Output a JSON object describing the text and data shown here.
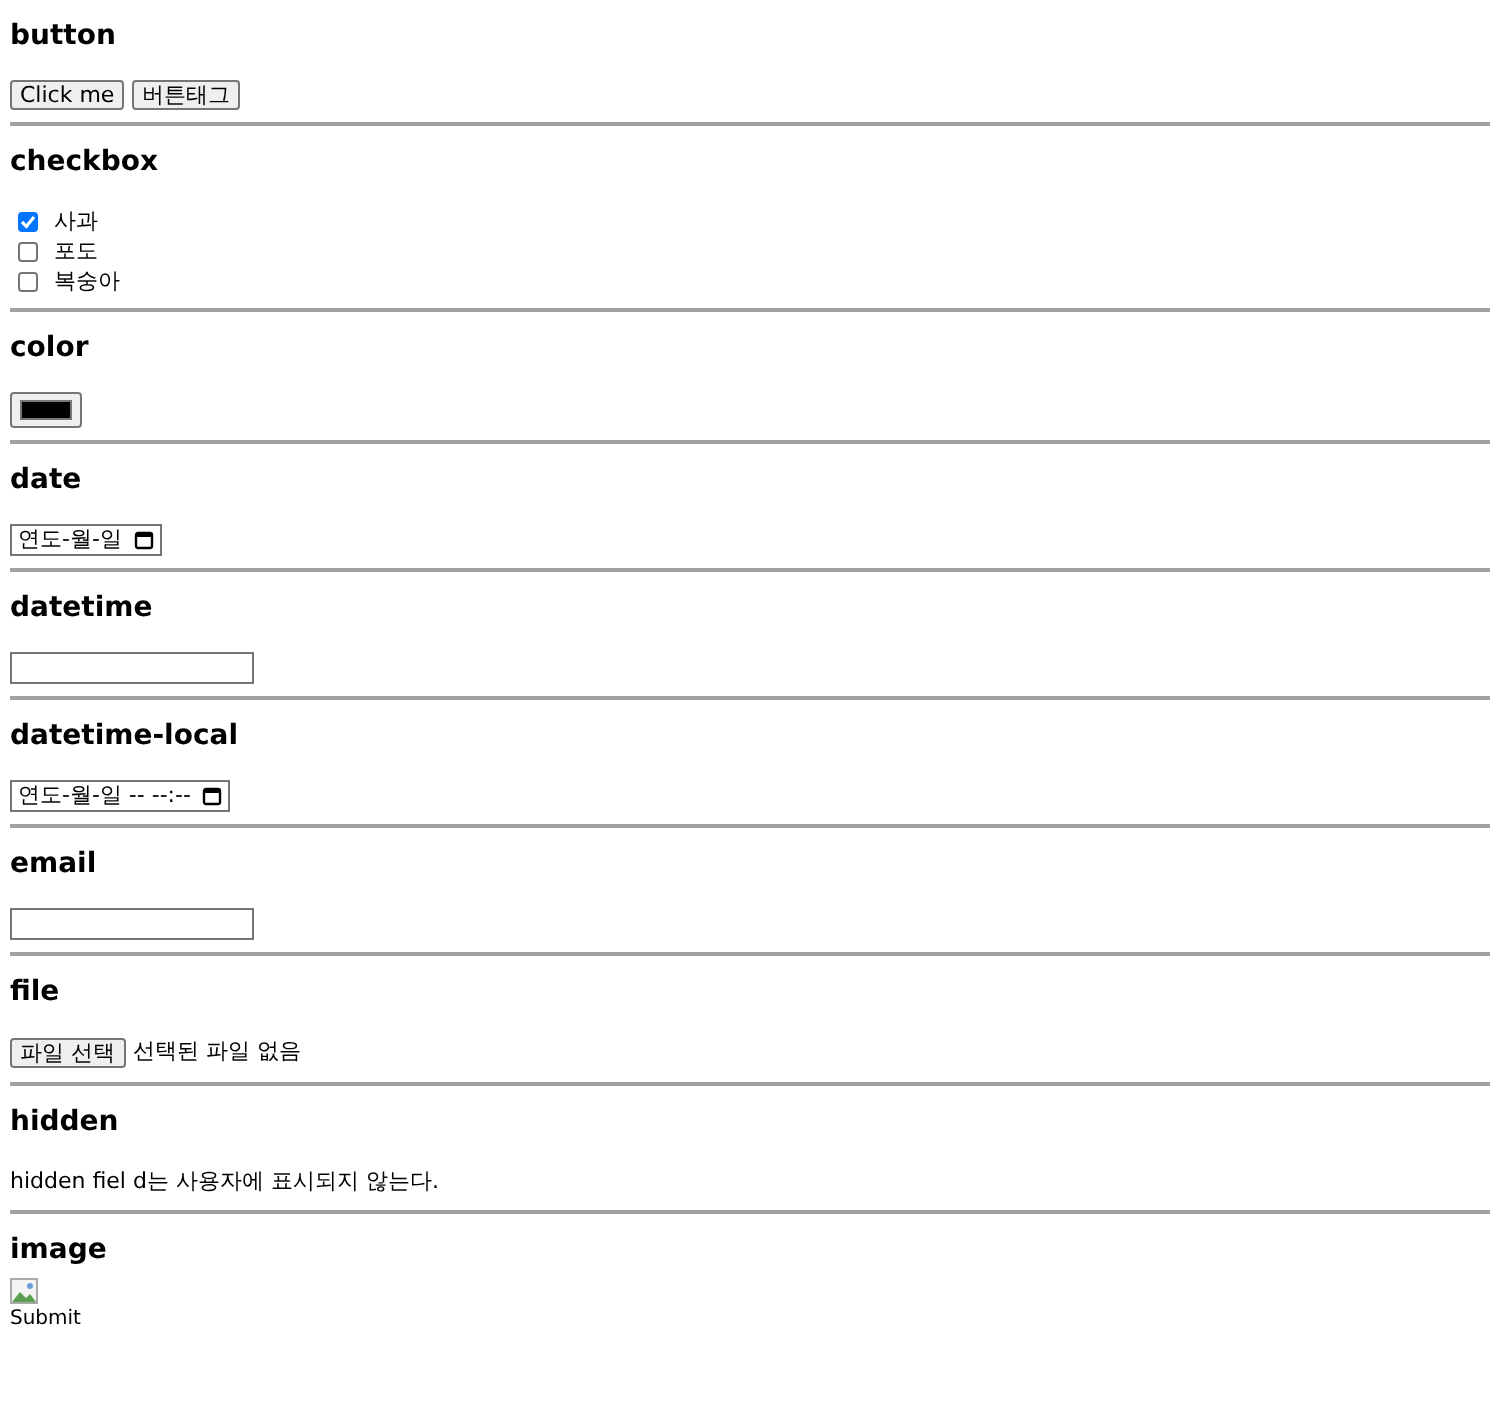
{
  "sections": [
    {
      "kind": "buttons",
      "heading": "button",
      "buttons": [
        "Click me",
        "버튼태그"
      ]
    },
    {
      "kind": "checkboxes",
      "heading": "checkbox",
      "options": [
        {
          "label": "사과",
          "checked": true
        },
        {
          "label": "포도",
          "checked": false
        },
        {
          "label": "복숭아",
          "checked": false
        }
      ]
    },
    {
      "kind": "color",
      "heading": "color",
      "color": "#000000"
    },
    {
      "kind": "date",
      "heading": "date",
      "text": "연도-월-일"
    },
    {
      "kind": "text",
      "heading": "datetime"
    },
    {
      "kind": "date",
      "heading": "datetime-local",
      "text": "연도-월-일 -- --:--"
    },
    {
      "kind": "text",
      "heading": "email"
    },
    {
      "kind": "file",
      "heading": "file",
      "button": "파일 선택",
      "status": "선택된 파일 없음"
    },
    {
      "kind": "paragraph",
      "heading": "hidden",
      "text": "hidden fiel d는 사용자에 표시되지 않는다."
    },
    {
      "kind": "image",
      "heading": "image",
      "alt": "Submit"
    }
  ]
}
